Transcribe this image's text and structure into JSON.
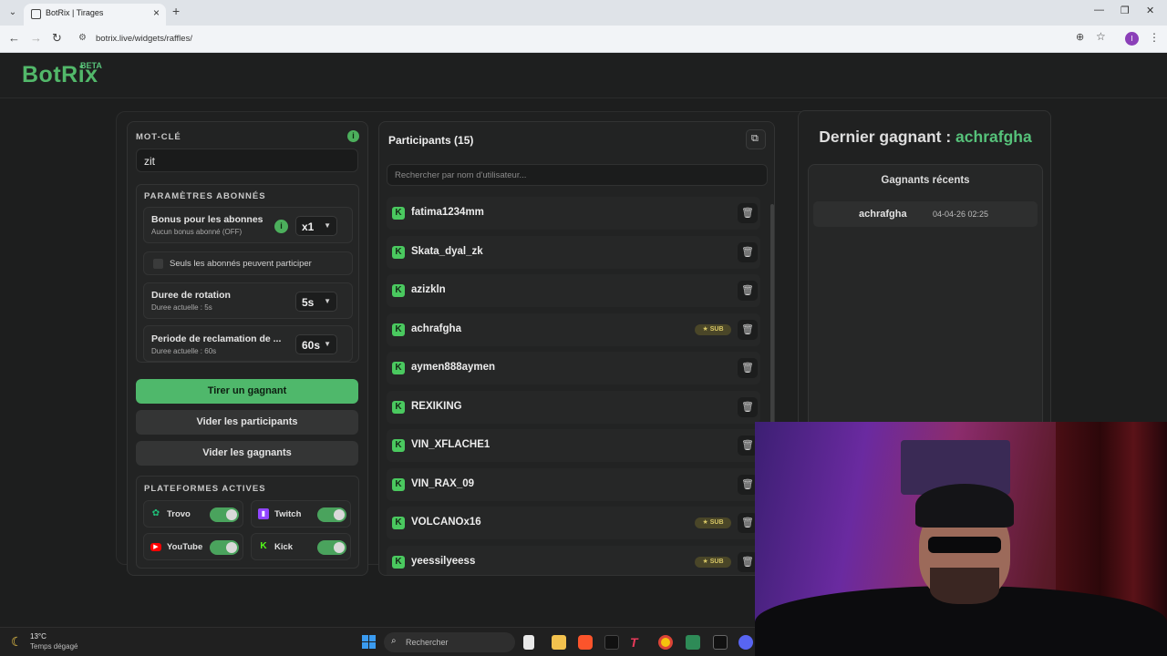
{
  "browser": {
    "tab_title": "BotRix | Tirages",
    "url": "botrix.live/widgets/raffles/"
  },
  "app": {
    "logo": "BotRix",
    "beta": "BETA"
  },
  "left": {
    "keyword_label": "MOT-CLÉ",
    "keyword_value": "zit",
    "subs_section_label": "PARAMÈTRES ABONNÉS",
    "bonus_title": "Bonus pour les abonnes",
    "bonus_sub": "Aucun bonus abonné (OFF)",
    "bonus_select": "x1",
    "subs_only_label": "Seuls les abonnés peuvent participer",
    "rotation_title": "Duree de rotation",
    "rotation_sub": "Duree actuelle : 5s",
    "rotation_select": "5s",
    "claim_title": "Periode de reclamation de ...",
    "claim_sub": "Duree actuelle : 60s",
    "claim_select": "60s",
    "draw_button": "Tirer un gagnant",
    "clear_participants_button": "Vider les participants",
    "clear_winners_button": "Vider les gagnants",
    "platforms_label": "PLATEFORMES ACTIVES",
    "platforms": [
      {
        "name": "Trovo",
        "enabled": true,
        "color": "#1fc27a"
      },
      {
        "name": "Twitch",
        "enabled": true,
        "color": "#9146ff"
      },
      {
        "name": "YouTube",
        "enabled": true,
        "color": "#ff0000"
      },
      {
        "name": "Kick",
        "enabled": true,
        "color": "#53fc18"
      }
    ]
  },
  "middle": {
    "title": "Participants (15)",
    "search_placeholder": "Rechercher par nom d'utilisateur...",
    "sub_badge": "★ SUB",
    "participants": [
      {
        "name": "fatima1234mm",
        "sub": false
      },
      {
        "name": "Skata_dyal_zk",
        "sub": false
      },
      {
        "name": "azizkln",
        "sub": false
      },
      {
        "name": "achrafgha",
        "sub": true
      },
      {
        "name": "aymen888aymen",
        "sub": false
      },
      {
        "name": "REXIKING",
        "sub": false
      },
      {
        "name": "VIN_XFLACHE1",
        "sub": false
      },
      {
        "name": "VIN_RAX_09",
        "sub": false
      },
      {
        "name": "VOLCANOx16",
        "sub": true
      },
      {
        "name": "yeessilyeess",
        "sub": true
      }
    ]
  },
  "right": {
    "winner_label": "Dernier gagnant : ",
    "winner_name": "achrafgha",
    "recent_title": "Gagnants récents",
    "recent": [
      {
        "name": "achrafgha",
        "date": "04-04-26 02:25"
      }
    ]
  },
  "taskbar": {
    "temp": "13°C",
    "weather": "Temps dégagé",
    "search": "Rechercher"
  },
  "colors": {
    "accent_green": "#4fb86b",
    "background": "#1d1e1e"
  }
}
